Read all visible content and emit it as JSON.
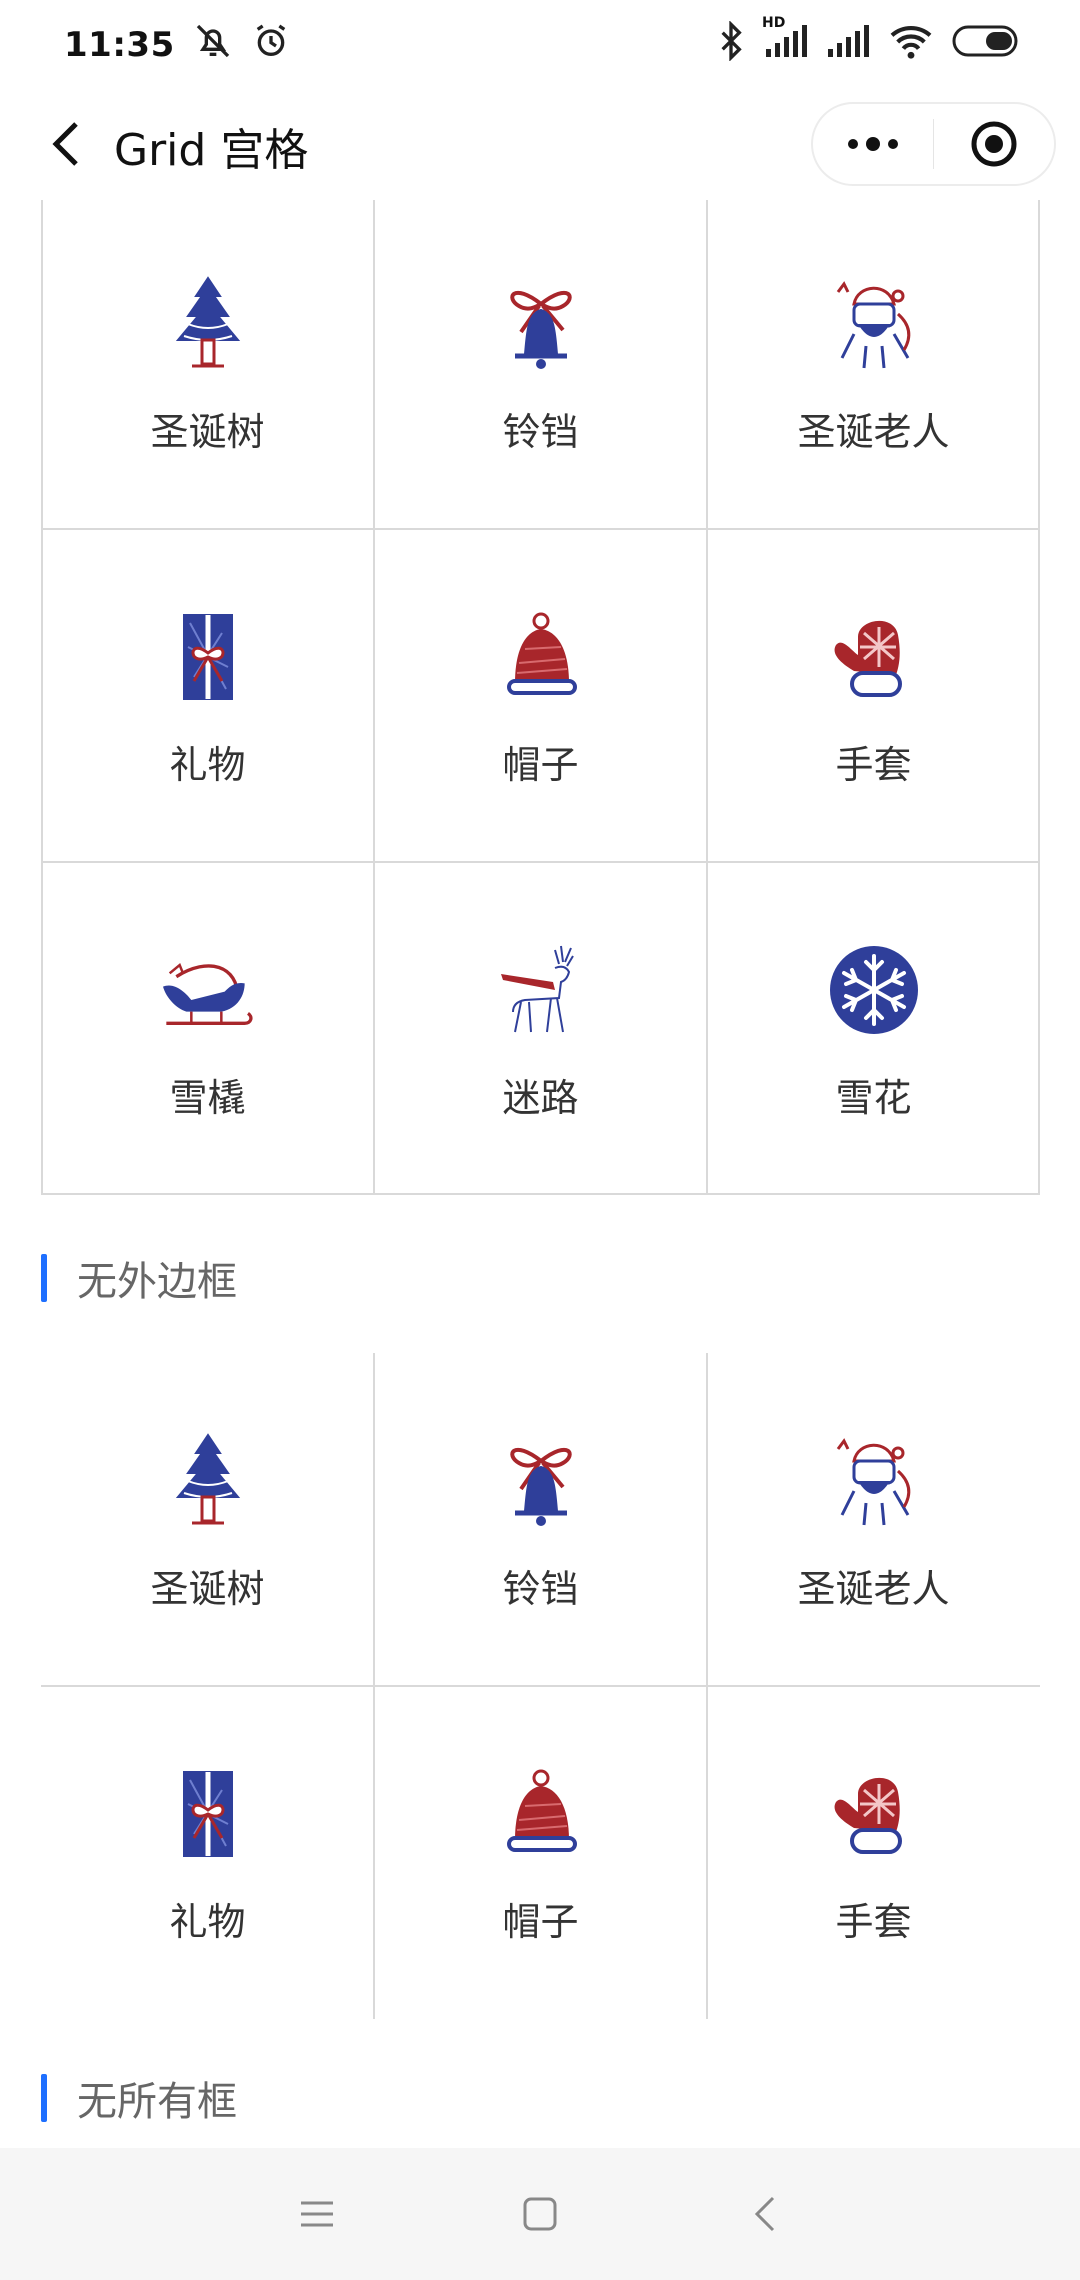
{
  "status": {
    "time": "11:35",
    "network": "HD"
  },
  "nav": {
    "title": "Grid 宫格"
  },
  "grid_bordered": {
    "items": [
      {
        "label": "圣诞树",
        "icon": "christmas-tree-icon"
      },
      {
        "label": "铃铛",
        "icon": "bell-icon"
      },
      {
        "label": "圣诞老人",
        "icon": "santa-icon"
      },
      {
        "label": "礼物",
        "icon": "gift-icon"
      },
      {
        "label": "帽子",
        "icon": "hat-icon"
      },
      {
        "label": "手套",
        "icon": "mitten-icon"
      },
      {
        "label": "雪橇",
        "icon": "sleigh-icon"
      },
      {
        "label": "迷路",
        "icon": "reindeer-icon"
      },
      {
        "label": "雪花",
        "icon": "snowflake-icon"
      }
    ]
  },
  "section_no_outer_border": {
    "title": "无外边框"
  },
  "grid_no_outer": {
    "items": [
      {
        "label": "圣诞树",
        "icon": "christmas-tree-icon"
      },
      {
        "label": "铃铛",
        "icon": "bell-icon"
      },
      {
        "label": "圣诞老人",
        "icon": "santa-icon"
      },
      {
        "label": "礼物",
        "icon": "gift-icon"
      },
      {
        "label": "帽子",
        "icon": "hat-icon"
      },
      {
        "label": "手套",
        "icon": "mitten-icon"
      }
    ]
  },
  "section_no_border": {
    "title": "无所有框"
  },
  "colors": {
    "accent": "#1e6fff",
    "icon_blue": "#2f3f9a",
    "icon_red": "#a8262b",
    "grid_line": "#d9d9d9"
  }
}
